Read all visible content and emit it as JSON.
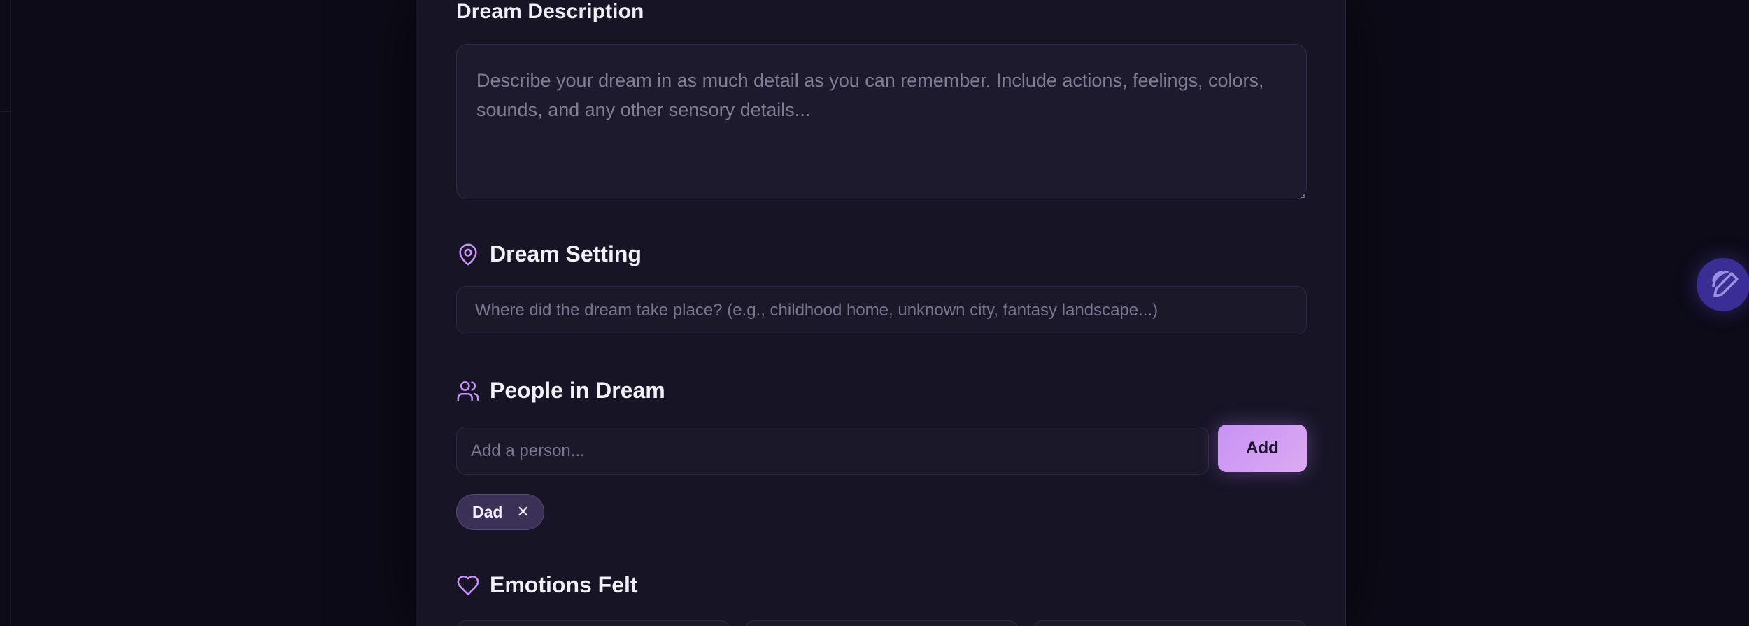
{
  "form": {
    "description": {
      "label": "Dream Description",
      "placeholder": "Describe your dream in as much detail as you can remember. Include actions, feelings, colors, sounds, and any other sensory details..."
    },
    "setting": {
      "title": "Dream Setting",
      "icon": "map-pin-icon",
      "placeholder": "Where did the dream take place? (e.g., childhood home, unknown city, fantasy landscape...)"
    },
    "people": {
      "title": "People in Dream",
      "icon": "users-icon",
      "placeholder": "Add a person...",
      "add_label": "Add",
      "tags": [
        {
          "label": "Dad",
          "remove_icon": "close-icon"
        }
      ]
    },
    "emotions": {
      "title": "Emotions Felt",
      "icon": "heart-icon"
    }
  },
  "fab": {
    "icon": "pencil-signal-icon"
  },
  "colors": {
    "accent": "#c792f5",
    "panel": "#171426",
    "background": "#0c0b17",
    "fab": "#3a2d93"
  }
}
